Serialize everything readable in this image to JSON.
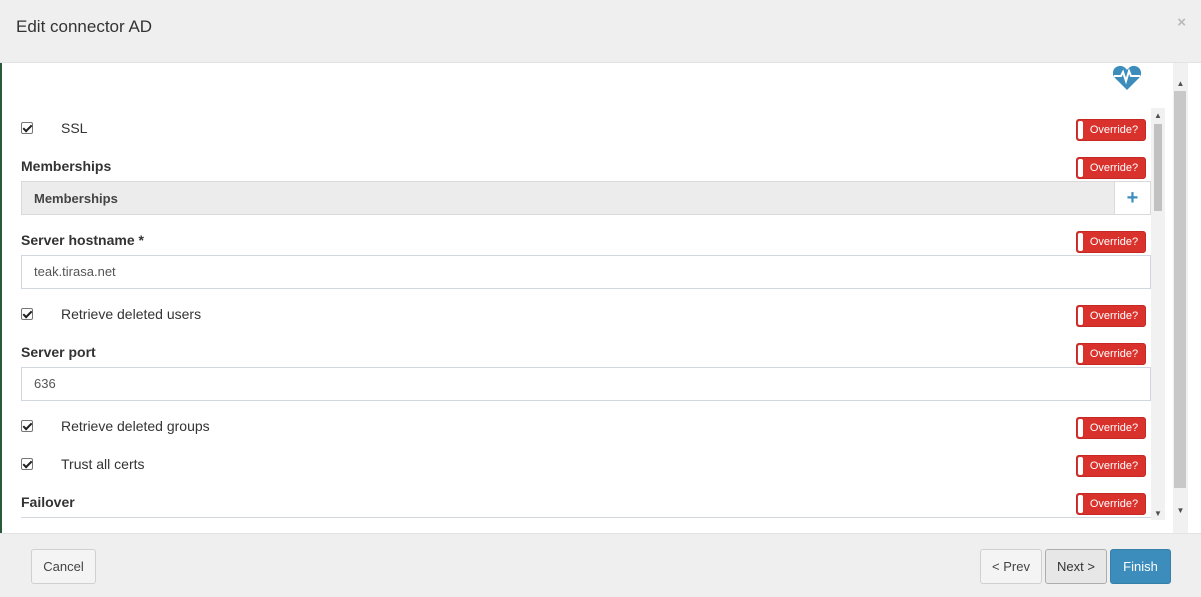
{
  "dialog": {
    "title": "Edit connector AD",
    "close_glyph": "×"
  },
  "icons": {
    "health": "heart-pulse-icon",
    "add": "plus-icon",
    "close": "close-icon"
  },
  "colors": {
    "override_bg": "#d9312b",
    "primary": "#3c8dbc",
    "header_bg": "#efefef"
  },
  "override_label": "Override?",
  "fields": {
    "ssl": {
      "label": "SSL",
      "checked": true
    },
    "memberships": {
      "label": "Memberships",
      "panel_title": "Memberships",
      "add_glyph": "+"
    },
    "server_hostname": {
      "label": "Server hostname *",
      "value": "teak.tirasa.net"
    },
    "retrieve_deleted_users": {
      "label": "Retrieve deleted users",
      "checked": true
    },
    "server_port": {
      "label": "Server port",
      "value": "636"
    },
    "retrieve_deleted_groups": {
      "label": "Retrieve deleted groups",
      "checked": true
    },
    "trust_all_certs": {
      "label": "Trust all certs",
      "checked": true
    },
    "failover": {
      "label": "Failover"
    }
  },
  "scroll": {
    "up_glyph": "▲",
    "down_glyph": "▼"
  },
  "footer": {
    "cancel": "Cancel",
    "prev": "< Prev",
    "next": "Next >",
    "finish": "Finish"
  }
}
